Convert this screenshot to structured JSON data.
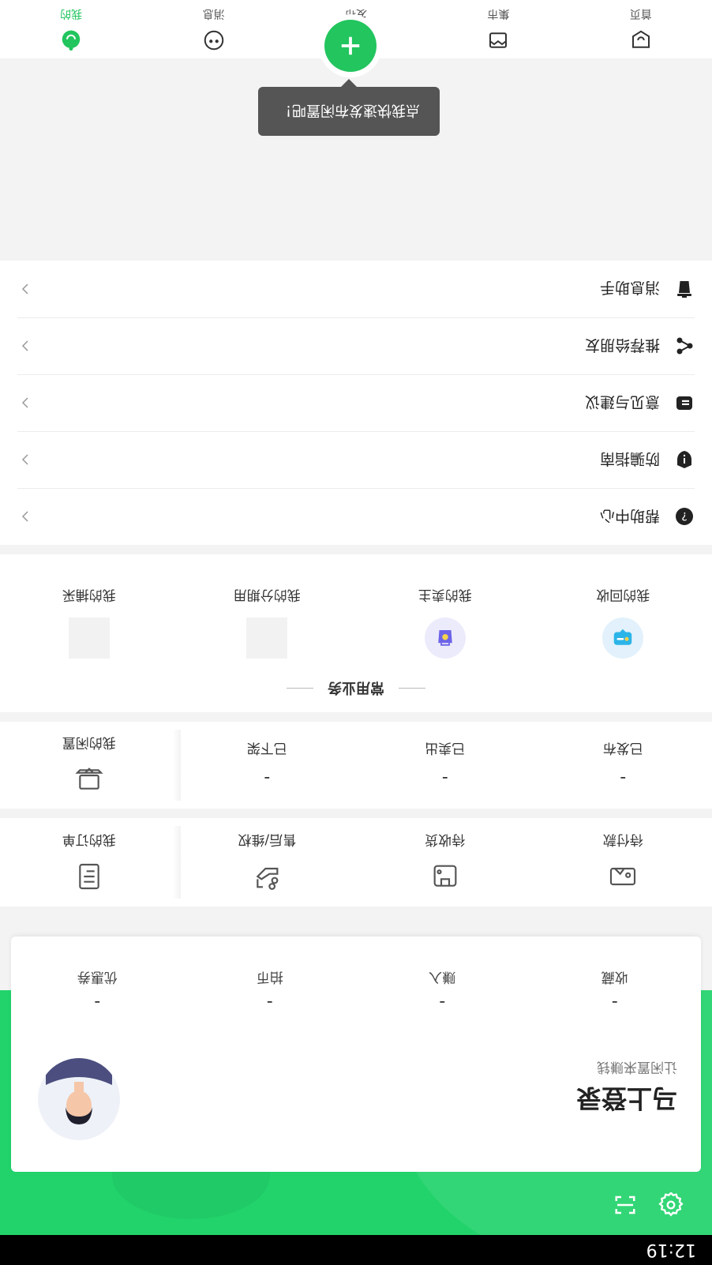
{
  "status_bar": {
    "time": "12:19"
  },
  "profile": {
    "title": "马上登录",
    "subtitle": "让闲置来赚钱",
    "stats": [
      {
        "value": "-",
        "label": "收藏"
      },
      {
        "value": "-",
        "label": "赚入"
      },
      {
        "value": "-",
        "label": "拍币"
      },
      {
        "value": "-",
        "label": "优惠券"
      }
    ]
  },
  "buy_section": {
    "items": [
      {
        "label": "待付款",
        "icon": "wallet-icon"
      },
      {
        "label": "待收货",
        "icon": "package-icon"
      },
      {
        "label": "售后/维权",
        "icon": "after-sale-icon"
      },
      {
        "label": "我的订单",
        "icon": "order-list-icon"
      }
    ]
  },
  "sell_section": {
    "items": [
      {
        "value": "-",
        "label": "已发布"
      },
      {
        "value": "-",
        "label": "已卖出"
      },
      {
        "value": "-",
        "label": "已下架"
      },
      {
        "label": "我的闲置",
        "icon": "laptop-icon"
      }
    ]
  },
  "services": {
    "title": "常用业务",
    "items": [
      {
        "label": "我的回收",
        "icon": "recycle-screen-icon"
      },
      {
        "label": "我的卖主",
        "icon": "seller-bag-icon"
      },
      {
        "label": "我的分期用",
        "icon": ""
      },
      {
        "label": "我的捕采",
        "icon": ""
      }
    ]
  },
  "menu": [
    {
      "label": "帮助中心",
      "icon": "help-icon"
    },
    {
      "label": "防骗指南",
      "icon": "shield-icon"
    },
    {
      "label": "意见与建议",
      "icon": "feedback-icon"
    },
    {
      "label": "推荐给朋友",
      "icon": "share-icon"
    },
    {
      "label": "消息助手",
      "icon": "trash-icon"
    }
  ],
  "tooltip": {
    "text": "点我快速发布闲置吧！"
  },
  "tabbar": {
    "tabs": [
      {
        "label": "首页",
        "icon": "home-icon",
        "active": false
      },
      {
        "label": "集市",
        "icon": "market-icon",
        "active": false
      },
      {
        "label": "发布",
        "icon": "publish-icon",
        "active": false
      },
      {
        "label": "消息",
        "icon": "message-icon",
        "active": false
      },
      {
        "label": "我的",
        "icon": "profile-icon",
        "active": true
      }
    ]
  },
  "colors": {
    "accent": "#22c55e",
    "header_green": "#22d36b",
    "tooltip_bg": "#555555"
  }
}
